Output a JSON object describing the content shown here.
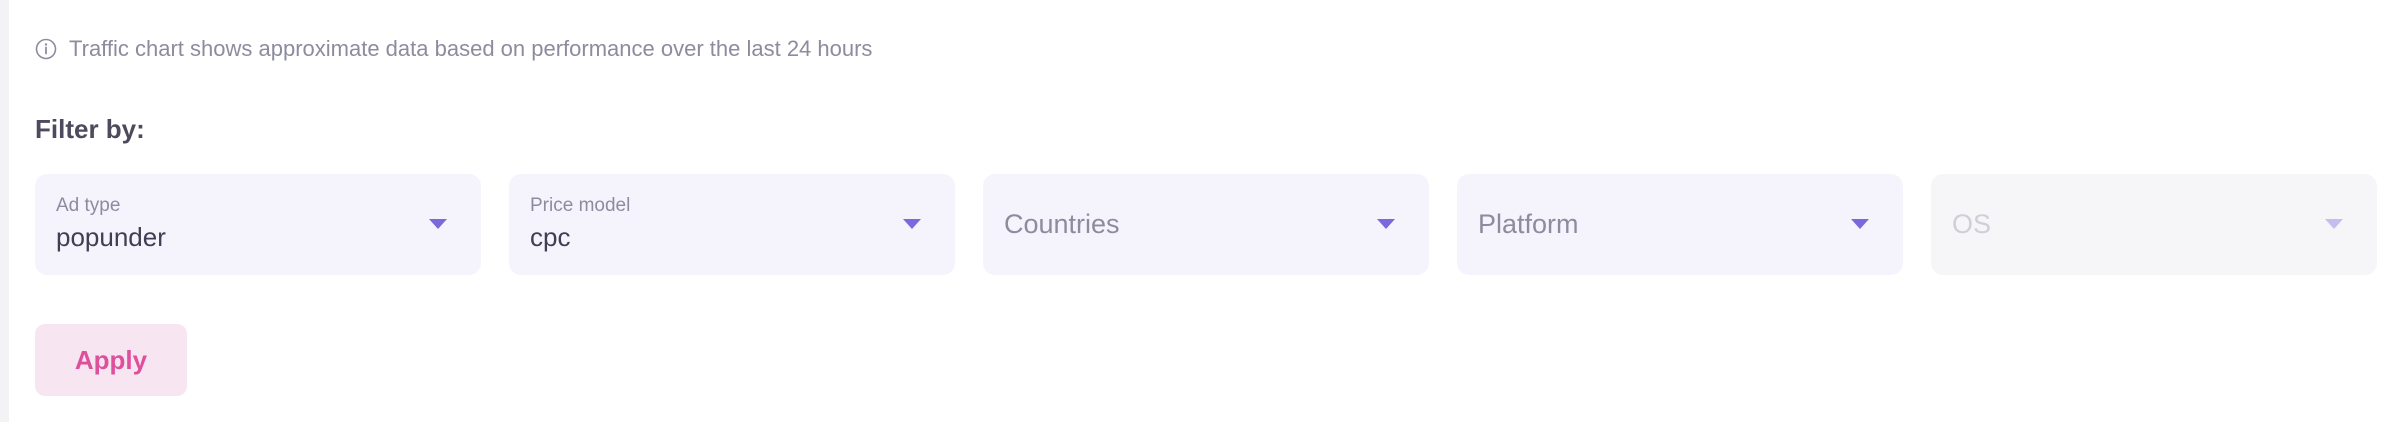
{
  "info": {
    "icon": "info-circle-icon",
    "text": "Traffic chart shows approximate data based on performance over the last 24 hours"
  },
  "filters": {
    "title": "Filter by:",
    "ad_type": {
      "label": "Ad type",
      "value": "popunder"
    },
    "price_model": {
      "label": "Price model",
      "value": "cpc"
    },
    "countries": {
      "placeholder": "Countries"
    },
    "platform": {
      "placeholder": "Platform"
    },
    "os": {
      "placeholder": "OS",
      "disabled": true
    }
  },
  "actions": {
    "apply_label": "Apply"
  },
  "colors": {
    "accent": "#7b68dc",
    "apply_text": "#de4f9c",
    "apply_bg": "#f7e6f2",
    "select_bg": "#f5f4fd",
    "muted_text": "#8d8c9f"
  }
}
